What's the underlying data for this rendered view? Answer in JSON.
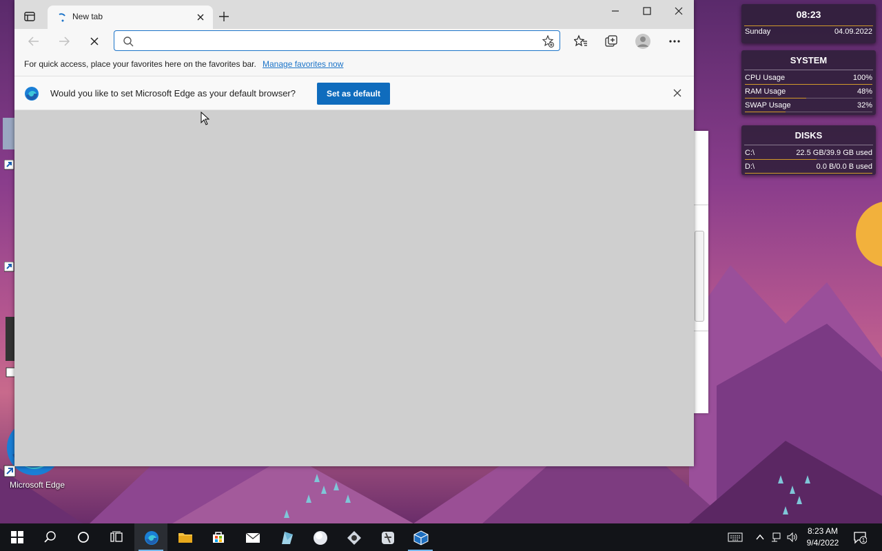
{
  "desktop": {
    "edge_icon_label": "Microsoft Edge"
  },
  "browser": {
    "tab": {
      "title": "New tab"
    },
    "address": {
      "value": "",
      "placeholder": ""
    },
    "favorites_bar": {
      "text": "For quick access, place your favorites here on the favorites bar.",
      "link": "Manage favorites now"
    },
    "infobar": {
      "message": "Would you like to set Microsoft Edge as your default browser?",
      "button": "Set as default"
    },
    "colors": {
      "accent": "#0f6cbd",
      "link": "#1a73c8"
    }
  },
  "widgets": {
    "clock": {
      "time": "08:23",
      "day": "Sunday",
      "date": "04.09.2022"
    },
    "system": {
      "title": "SYSTEM",
      "rows": [
        {
          "label": "CPU Usage",
          "value": "100%",
          "fraction": 1.0
        },
        {
          "label": "RAM Usage",
          "value": "48%",
          "fraction": 0.48
        },
        {
          "label": "SWAP Usage",
          "value": "32%",
          "fraction": 0.32
        }
      ]
    },
    "disks": {
      "title": "DISKS",
      "rows": [
        {
          "label": "C:\\",
          "value": "22.5 GB/39.9 GB used",
          "fraction": 0.56
        },
        {
          "label": "D:\\",
          "value": "0.0 B/0.0 B used",
          "fraction": 1.0
        }
      ]
    },
    "accent_color": "#d39b2a"
  },
  "taskbar": {
    "items": [
      "start-icon",
      "search-icon",
      "cortana-icon",
      "task-view-icon",
      "edge-icon",
      "file-explorer-icon",
      "store-icon",
      "mail-icon",
      "app-icon",
      "app-icon",
      "app-icon",
      "app-icon",
      "virtualbox-icon"
    ],
    "clock": {
      "time": "8:23 AM",
      "date": "9/4/2022"
    },
    "notification_count": "1"
  }
}
